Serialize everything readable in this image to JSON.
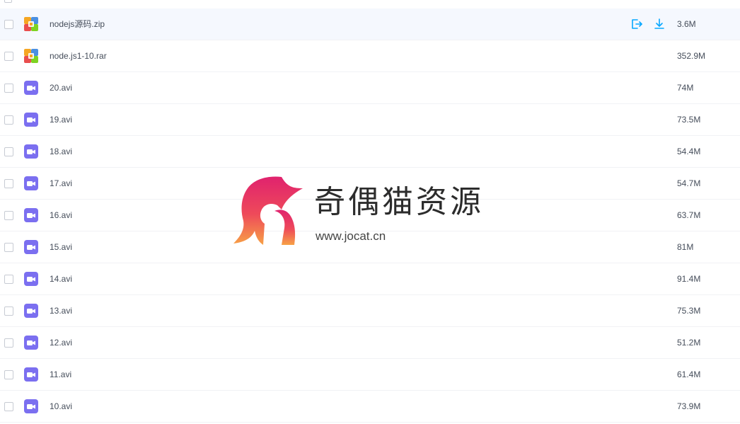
{
  "files": [
    {
      "name": "nodejs源码.zip",
      "size": "3.6M",
      "type": "archive",
      "hover": true
    },
    {
      "name": "node.js1-10.rar",
      "size": "352.9M",
      "type": "archive",
      "hover": false
    },
    {
      "name": "20.avi",
      "size": "74M",
      "type": "video",
      "hover": false
    },
    {
      "name": "19.avi",
      "size": "73.5M",
      "type": "video",
      "hover": false
    },
    {
      "name": "18.avi",
      "size": "54.4M",
      "type": "video",
      "hover": false
    },
    {
      "name": "17.avi",
      "size": "54.7M",
      "type": "video",
      "hover": false
    },
    {
      "name": "16.avi",
      "size": "63.7M",
      "type": "video",
      "hover": false
    },
    {
      "name": "15.avi",
      "size": "81M",
      "type": "video",
      "hover": false
    },
    {
      "name": "14.avi",
      "size": "91.4M",
      "type": "video",
      "hover": false
    },
    {
      "name": "13.avi",
      "size": "75.3M",
      "type": "video",
      "hover": false
    },
    {
      "name": "12.avi",
      "size": "51.2M",
      "type": "video",
      "hover": false
    },
    {
      "name": "11.avi",
      "size": "61.4M",
      "type": "video",
      "hover": false
    },
    {
      "name": "10.avi",
      "size": "73.9M",
      "type": "video",
      "hover": false
    }
  ],
  "row_actions": [
    {
      "icon": "share-icon"
    },
    {
      "icon": "download-icon"
    }
  ],
  "watermark": {
    "title": "奇偶猫资源",
    "url": "www.jocat.cn"
  },
  "colors": {
    "accent": "#06a7ff",
    "video_icon": "#7b6ff0",
    "hover_row": "#f5f8fe",
    "text": "#454d5a"
  }
}
